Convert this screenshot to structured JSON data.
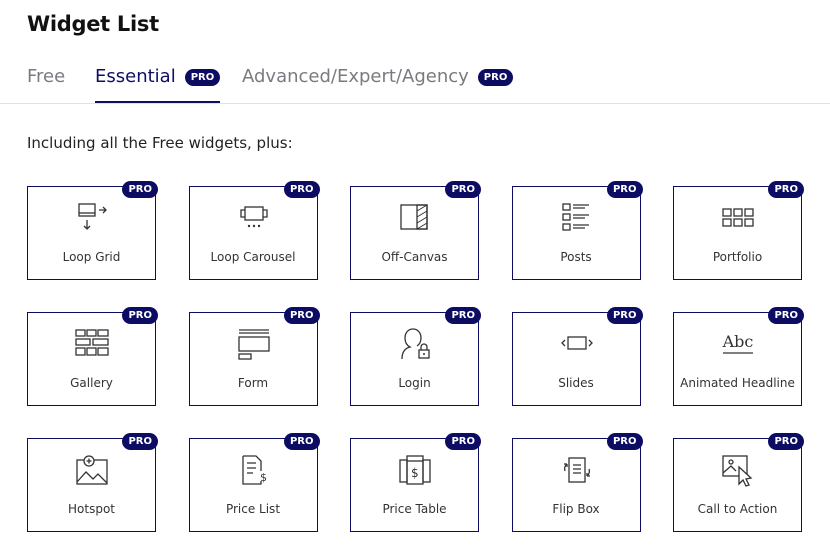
{
  "page": {
    "title": "Widget List"
  },
  "tabs": [
    {
      "label": "Free",
      "badge": ""
    },
    {
      "label": "Essential",
      "badge": "PRO"
    },
    {
      "label": "Advanced/Expert/Agency",
      "badge": "PRO"
    }
  ],
  "active_tab": "Essential",
  "intro": "Including all the Free widgets, plus:",
  "widgets": [
    {
      "label": "Loop Grid",
      "badge": "PRO",
      "icon": "loop-grid-icon"
    },
    {
      "label": "Loop Carousel",
      "badge": "PRO",
      "icon": "loop-carousel-icon"
    },
    {
      "label": "Off-Canvas",
      "badge": "PRO",
      "icon": "off-canvas-icon"
    },
    {
      "label": "Posts",
      "badge": "PRO",
      "icon": "posts-icon"
    },
    {
      "label": "Portfolio",
      "badge": "PRO",
      "icon": "portfolio-icon"
    },
    {
      "label": "Gallery",
      "badge": "PRO",
      "icon": "gallery-icon"
    },
    {
      "label": "Form",
      "badge": "PRO",
      "icon": "form-icon"
    },
    {
      "label": "Login",
      "badge": "PRO",
      "icon": "login-icon"
    },
    {
      "label": "Slides",
      "badge": "PRO",
      "icon": "slides-icon"
    },
    {
      "label": "Animated Headline",
      "badge": "PRO",
      "icon": "animated-headline-icon",
      "icon_text": "Abc"
    },
    {
      "label": "Hotspot",
      "badge": "PRO",
      "icon": "hotspot-icon"
    },
    {
      "label": "Price List",
      "badge": "PRO",
      "icon": "price-list-icon"
    },
    {
      "label": "Price Table",
      "badge": "PRO",
      "icon": "price-table-icon"
    },
    {
      "label": "Flip Box",
      "badge": "PRO",
      "icon": "flip-box-icon"
    },
    {
      "label": "Call to Action",
      "badge": "PRO",
      "icon": "call-to-action-icon"
    }
  ],
  "colors": {
    "accent": "#0c0c63",
    "tab_inactive": "#7a7a80"
  }
}
